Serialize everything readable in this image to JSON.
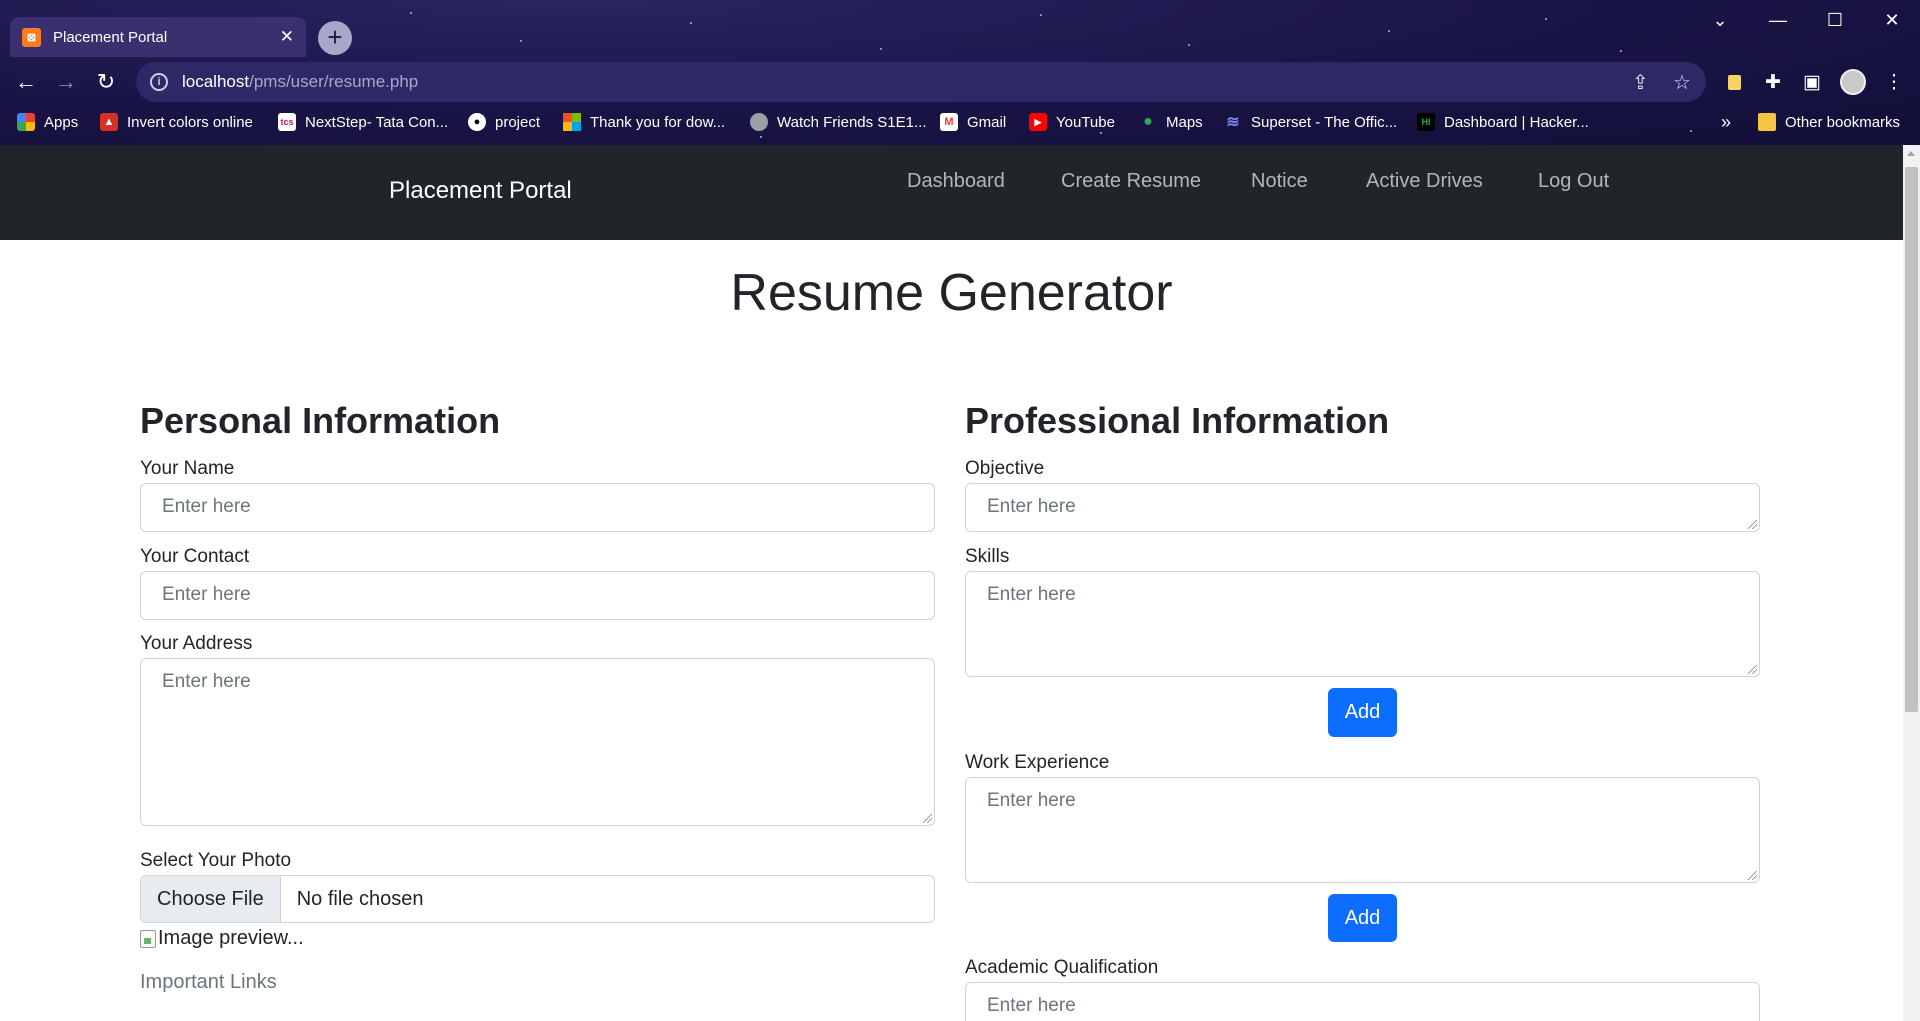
{
  "browser": {
    "tab_title": "Placement Portal",
    "tab_favicon_text": "⊠",
    "url_host": "localhost",
    "url_path": "/pms/user/resume.php",
    "bookmarks": [
      {
        "label": "Apps",
        "icon": "apps-grid-icon",
        "color": "#4285f4"
      },
      {
        "label": "Invert colors online",
        "icon": "tree-icon",
        "color": "#d93025"
      },
      {
        "label": "NextStep- Tata Con...",
        "icon": "tcs-icon",
        "color": "#ffffff"
      },
      {
        "label": "project",
        "icon": "github-icon",
        "color": "#ffffff"
      },
      {
        "label": "Thank you for dow...",
        "icon": "microsoft-icon",
        "color": "#f25022"
      },
      {
        "label": "Watch Friends S1E1...",
        "icon": "globe-icon",
        "color": "#9aa0a6"
      },
      {
        "label": "Gmail",
        "icon": "gmail-icon",
        "color": "#ea4335"
      },
      {
        "label": "YouTube",
        "icon": "youtube-icon",
        "color": "#ff0000"
      },
      {
        "label": "Maps",
        "icon": "maps-icon",
        "color": "#34a853"
      },
      {
        "label": "Superset - The Offic...",
        "icon": "superset-icon",
        "color": "#7b83eb"
      },
      {
        "label": "Dashboard | Hacker...",
        "icon": "hackerrank-icon",
        "color": "#1ba94c"
      }
    ],
    "overflow_label": "»",
    "other_bookmarks": "Other bookmarks"
  },
  "navbar": {
    "brand": "Placement Portal",
    "links": [
      "Dashboard",
      "Create Resume",
      "Notice",
      "Active Drives",
      "Log Out"
    ]
  },
  "page": {
    "title": "Resume Generator"
  },
  "personal": {
    "heading": "Personal Information",
    "name_label": "Your Name",
    "name_placeholder": "Enter here",
    "contact_label": "Your Contact",
    "contact_placeholder": "Enter here",
    "address_label": "Your Address",
    "address_placeholder": "Enter here",
    "photo_label": "Select Your Photo",
    "file_button": "Choose File",
    "file_status": "No file chosen",
    "image_preview_alt": "Image preview...",
    "important_links": "Important Links"
  },
  "professional": {
    "heading": "Professional Information",
    "objective_label": "Objective",
    "objective_placeholder": "Enter here",
    "skills_label": "Skills",
    "skills_placeholder": "Enter here",
    "skills_add": "Add",
    "work_label": "Work Experience",
    "work_placeholder": "Enter here",
    "work_add": "Add",
    "academic_label": "Academic Qualification",
    "academic_placeholder": "Enter here"
  },
  "colors": {
    "navbar_bg": "#212529",
    "primary": "#0d6efd"
  }
}
